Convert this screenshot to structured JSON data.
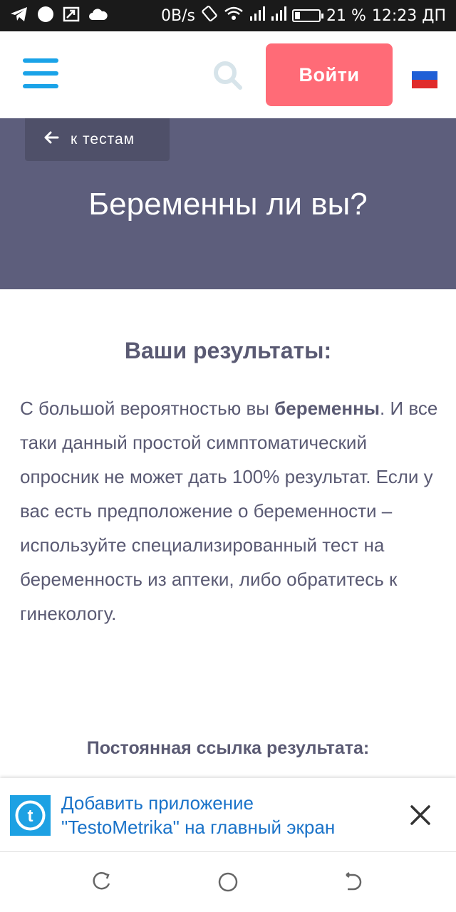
{
  "status_bar": {
    "net_speed": "0B/s",
    "battery_percent_text": "21 %",
    "battery_level": 0.21,
    "time": "12:23 ДП",
    "icons": [
      "telegram-icon",
      "dot-icon",
      "cast-icon",
      "cloud-icon",
      "rotate-icon",
      "wifi-icon",
      "signal-icon",
      "signal-icon",
      "battery-icon"
    ]
  },
  "header": {
    "login_label": "Войти",
    "flag_colors": [
      "#ffffff",
      "#1f5fd6",
      "#e02b2b"
    ],
    "accent": "#1aa3e8",
    "login_color": "#ff6b77"
  },
  "hero": {
    "back_label": "к тестам",
    "title": "Беременны ли вы?",
    "background": "#5d5e7c"
  },
  "content": {
    "results_heading": "Ваши результаты:",
    "result_prefix": "С большой вероятностью вы ",
    "result_bold": "беременны",
    "result_suffix": ". И все таки данный простой симптоматический опросник не может дать 100% результат. Если у вас есть предположение о беременности – используйте специализированный тест на беременность из аптеки, либо обратитесь к гинекологу.",
    "permalink_heading": "Постоянная ссылка результата:"
  },
  "banner": {
    "text_line1": "Добавить приложение",
    "text_line2": "\"TestoMetrika\" на главный экран",
    "icon_letter": "t"
  }
}
